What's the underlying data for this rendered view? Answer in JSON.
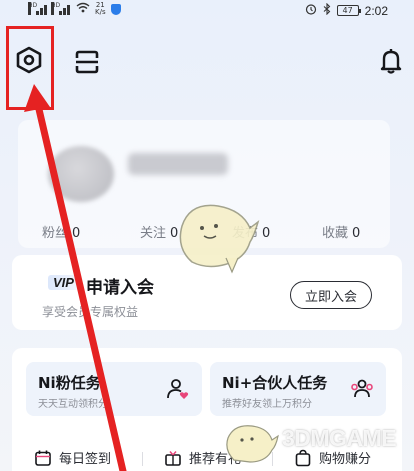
{
  "status_bar": {
    "net_tag_1": "HD",
    "net_tag_2": "HD",
    "speed_value": "21",
    "speed_unit": "K/s",
    "battery": "47",
    "time": "2:02"
  },
  "profile": {
    "stats": [
      {
        "label": "粉丝",
        "value": "0"
      },
      {
        "label": "关注",
        "value": "0"
      },
      {
        "label": "发布",
        "value": "0"
      },
      {
        "label": "收藏",
        "value": "0"
      }
    ]
  },
  "vip": {
    "badge": "VIP",
    "title": "申请入会",
    "subtitle": "享受会员专属权益",
    "join_label": "立即入会"
  },
  "tasks": [
    {
      "title": "Ni粉任务",
      "subtitle": "天天互动领积分"
    },
    {
      "title": "Ni+合伙人任务",
      "subtitle": "推荐好友领上万积分"
    }
  ],
  "quick_actions": [
    {
      "label": "每日签到"
    },
    {
      "label": "推荐有礼"
    },
    {
      "label": "购物赚分"
    }
  ],
  "icons": {
    "settings": "hexagon-gear-icon",
    "scan": "scan-icon",
    "notifications": "bell-icon",
    "task1": "user-heart-icon",
    "task2": "users-icon",
    "quick1": "calendar-icon",
    "quick2": "gift-icon",
    "quick3": "bag-icon"
  },
  "annotation": {
    "color": "#e52222"
  },
  "watermark": {
    "text": "3DMGAME"
  }
}
